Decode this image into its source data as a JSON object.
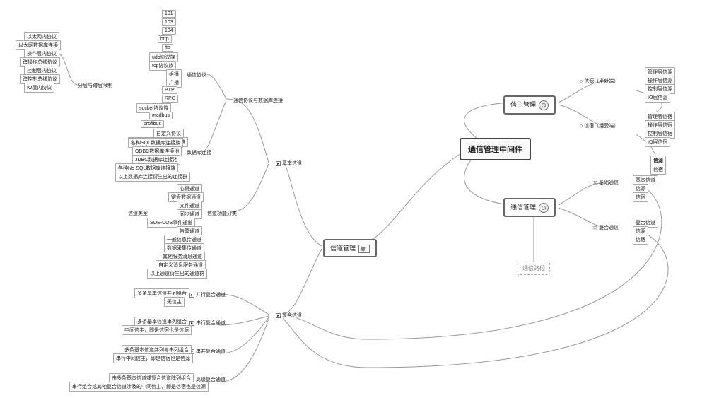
{
  "main": {
    "title": "通信管理中间件"
  },
  "blocks": {
    "sender_mgmt": "信主管理",
    "comm_mgmt": "通信管理",
    "channel_mgmt": "信道管理",
    "comm_path": "通信路径"
  },
  "right": {
    "source": {
      "label": "信源（发射端）",
      "items": [
        "管理层信源",
        "操作层信源",
        "控制层信源",
        "IO层信源"
      ]
    },
    "sink": {
      "label": "信宿（接受端）",
      "items": [
        "管理层信宿",
        "操作层信宿",
        "控制层信宿",
        "IO层信宿"
      ]
    },
    "basic_link": {
      "label": "基础通信",
      "items": [
        "基本信道",
        "信源",
        "信宿"
      ]
    },
    "complex_link": {
      "label": "复合通信",
      "items": [
        "复合信道",
        "信源",
        "信宿"
      ]
    },
    "src_tag": "信源",
    "sink_tag": "信宿"
  },
  "col0": {
    "label": "分层与跨层限制",
    "items": [
      "以太网内协议",
      "以太网数据库连接",
      "操作层内协议",
      "跨操作总线协议",
      "控制层内协议",
      "跨控制总线协议",
      "IO层内协议"
    ]
  },
  "protocol_db": {
    "label": "通信协议与数据库连接",
    "proto": {
      "label": "通信协议",
      "items": [
        "101",
        "103",
        "104",
        "http",
        "ftp",
        "udp协议族",
        "tcp协议族",
        "组播",
        "广播",
        "PTP",
        "RPC",
        "socket协议族",
        "modbus",
        "profibus",
        "自定义协议",
        "以上协议衍生出的协议群"
      ]
    },
    "db": {
      "label": "数据库连接",
      "items": [
        "各种SQL数据库连接族",
        "ODBC数据库连接池",
        "JDBC数据库连接池",
        "各种No-SQL数据库连接族",
        "以上数据库连接衍生出的连接群"
      ]
    }
  },
  "channel": {
    "basic_label": "基本信道",
    "type_label": "信道类型",
    "func_label": "信道功能分类",
    "func_items": [
      "心跳通道",
      "键盘数据通道",
      "文件通道",
      "同步通道",
      "SOE-COS事件通道",
      "告警通道",
      "一般信息传通道",
      "数据采集传通道",
      "其他服务消息通道",
      "自定义消息服务通道",
      "以上通道衍生出的通道群"
    ]
  },
  "composite": {
    "label": "复合信道",
    "rows": [
      {
        "name": "并行复合通道",
        "lines": [
          "多条基本信道并列组合",
          "无信主"
        ]
      },
      {
        "name": "串行复合通道",
        "lines": [
          "多条基本信道串列组合",
          "中间信主，即是信宿也是信源"
        ]
      },
      {
        "name": "串并复合通道",
        "lines": [
          "多条基本信道并列与串列组合",
          "串行中间信主，即是信宿也是信源"
        ]
      },
      {
        "name": "高级复合通道",
        "lines": [
          "由多条基本信道或复合信道阵列组合",
          "串行组合或其他复合信道涉及的中间信主，即是信宿也是信源"
        ]
      }
    ]
  }
}
